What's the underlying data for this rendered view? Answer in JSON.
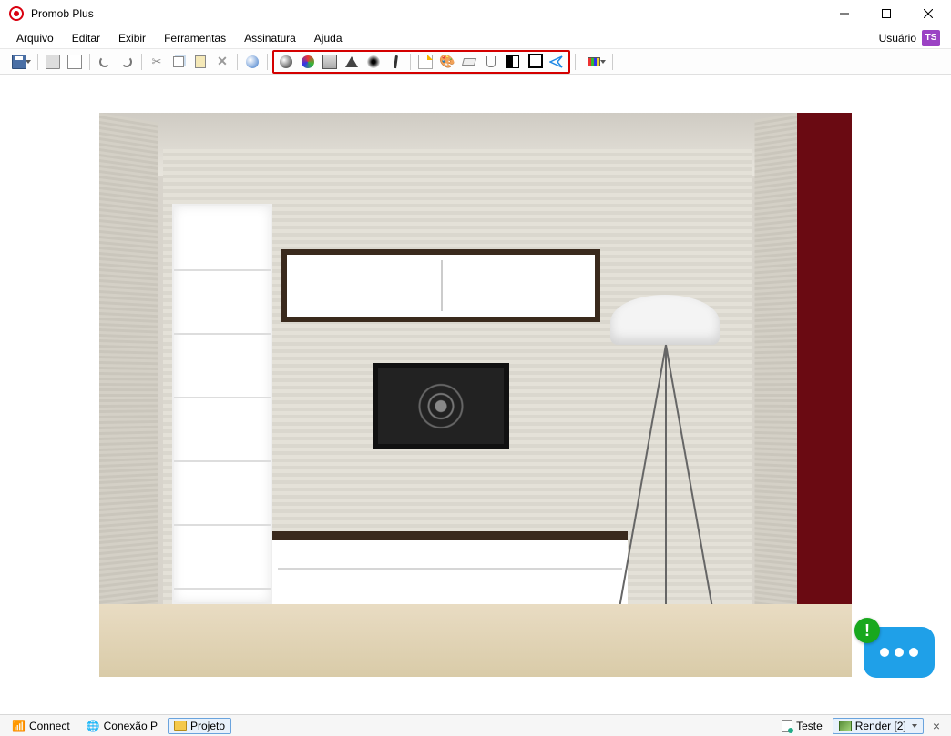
{
  "titlebar": {
    "title": "Promob Plus"
  },
  "menubar": {
    "items": [
      {
        "label": "Arquivo"
      },
      {
        "label": "Editar"
      },
      {
        "label": "Exibir"
      },
      {
        "label": "Ferramentas"
      },
      {
        "label": "Assinatura"
      },
      {
        "label": "Ajuda"
      }
    ],
    "user_label": "Usuário",
    "user_initials": "TS"
  },
  "toolbar": {
    "groups": {
      "file": [
        {
          "name": "save",
          "icon": "save",
          "dropdown": true
        }
      ],
      "print": [
        {
          "name": "print",
          "icon": "print"
        },
        {
          "name": "print-preview",
          "icon": "doc"
        }
      ],
      "history": [
        {
          "name": "undo",
          "icon": "undo"
        },
        {
          "name": "redo",
          "icon": "redo"
        }
      ],
      "clipboard": [
        {
          "name": "cut",
          "icon": "cut"
        },
        {
          "name": "copy",
          "icon": "copy"
        },
        {
          "name": "paste",
          "icon": "paste"
        },
        {
          "name": "delete",
          "icon": "x"
        }
      ],
      "view-prefix": [
        {
          "name": "world",
          "icon": "globe"
        }
      ],
      "render-highlighted": [
        {
          "name": "render-sphere",
          "icon": "sphere"
        },
        {
          "name": "render-rgb",
          "icon": "rgb"
        },
        {
          "name": "save-image",
          "icon": "saveimg"
        },
        {
          "name": "edges",
          "icon": "tri"
        },
        {
          "name": "soft-shadow",
          "icon": "blur"
        },
        {
          "name": "edit-light",
          "icon": "pen"
        },
        {
          "name": "new-page",
          "icon": "page"
        },
        {
          "name": "paint",
          "icon": "paint"
        },
        {
          "name": "eraser",
          "icon": "erase"
        },
        {
          "name": "material-glass",
          "icon": "glass"
        },
        {
          "name": "contrast",
          "icon": "contrast"
        },
        {
          "name": "crop",
          "icon": "crop"
        },
        {
          "name": "send",
          "icon": "send"
        }
      ],
      "palette": [
        {
          "name": "color-palette",
          "icon": "palette",
          "dropdown": true
        }
      ]
    }
  },
  "statusbar": {
    "connect_label": "Connect",
    "connection_label": "Conexão P",
    "project_label": "Projeto",
    "test_label": "Teste",
    "render_label": "Render [2]"
  },
  "chat": {
    "badge": "!"
  }
}
